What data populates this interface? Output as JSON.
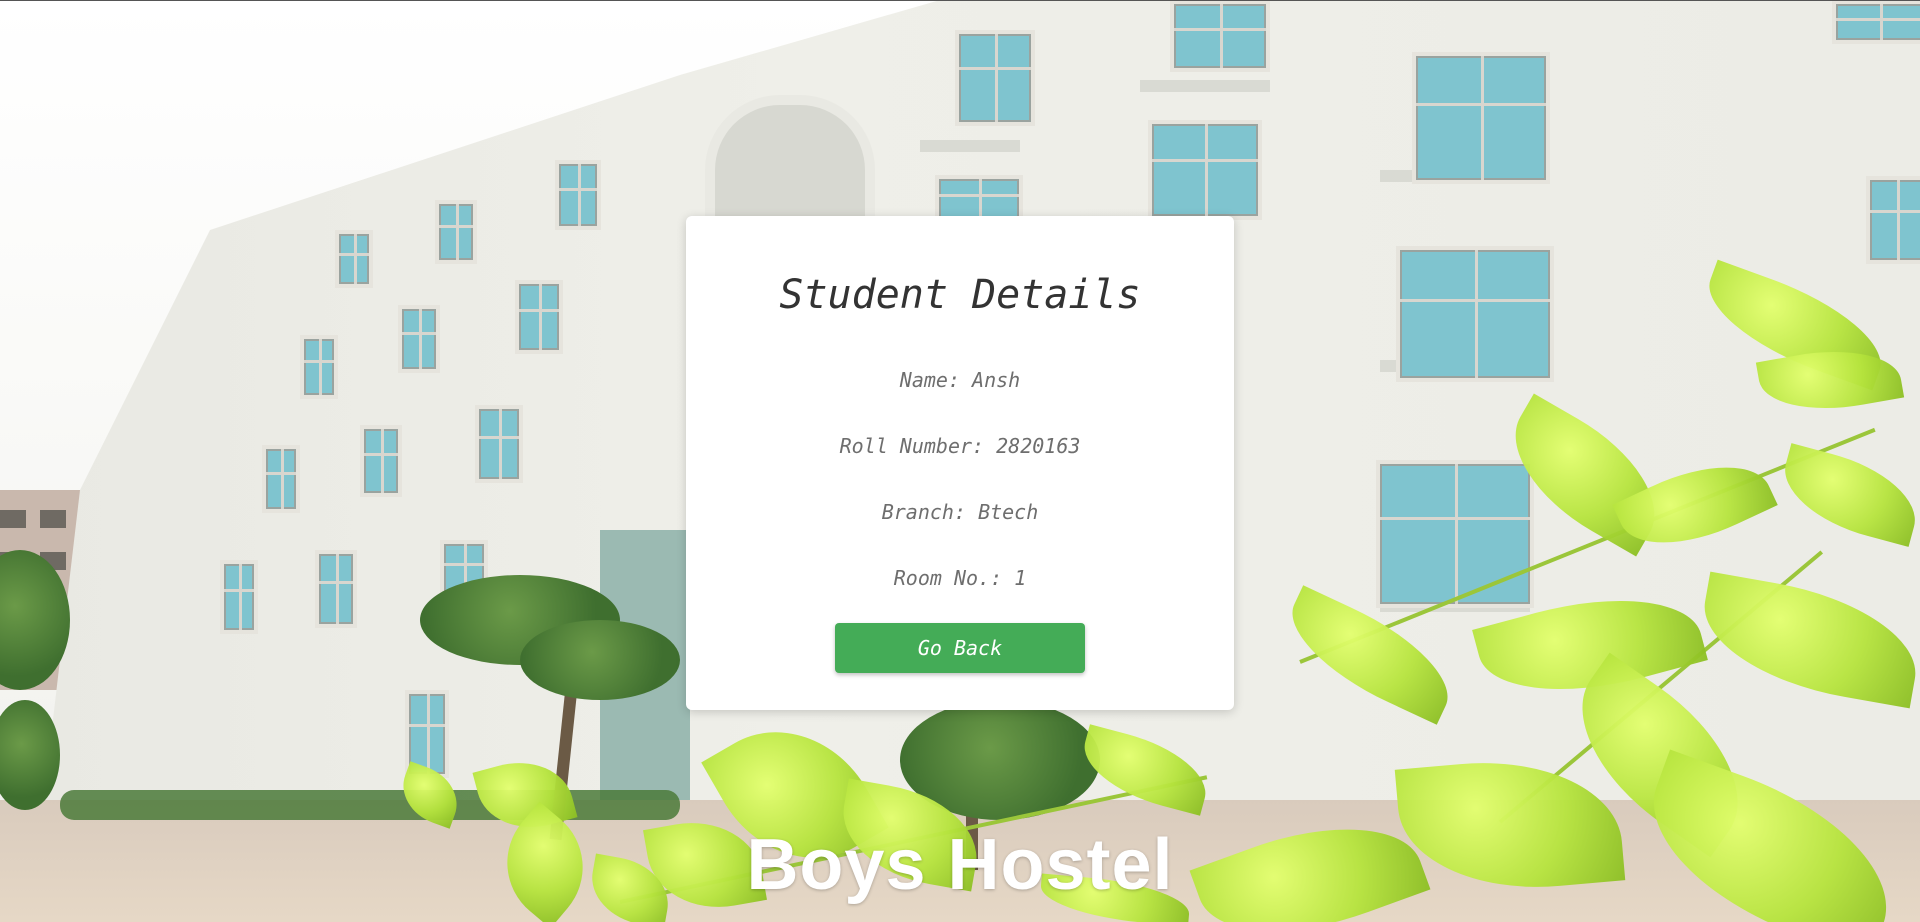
{
  "card": {
    "title": "Student Details",
    "details": [
      {
        "label": "Name:",
        "value": "Ansh"
      },
      {
        "label": "Roll Number:",
        "value": "2820163"
      },
      {
        "label": "Branch:",
        "value": "Btech"
      },
      {
        "label": "Room No.:",
        "value": "1"
      }
    ],
    "back_button": "Go Back"
  },
  "background": {
    "caption": "Boys Hostel"
  },
  "colors": {
    "button": "#44ac57",
    "title_text": "#333333",
    "detail_text": "#6e6e6e",
    "card_bg": "#ffffff",
    "caption_text": "#ffffff"
  }
}
